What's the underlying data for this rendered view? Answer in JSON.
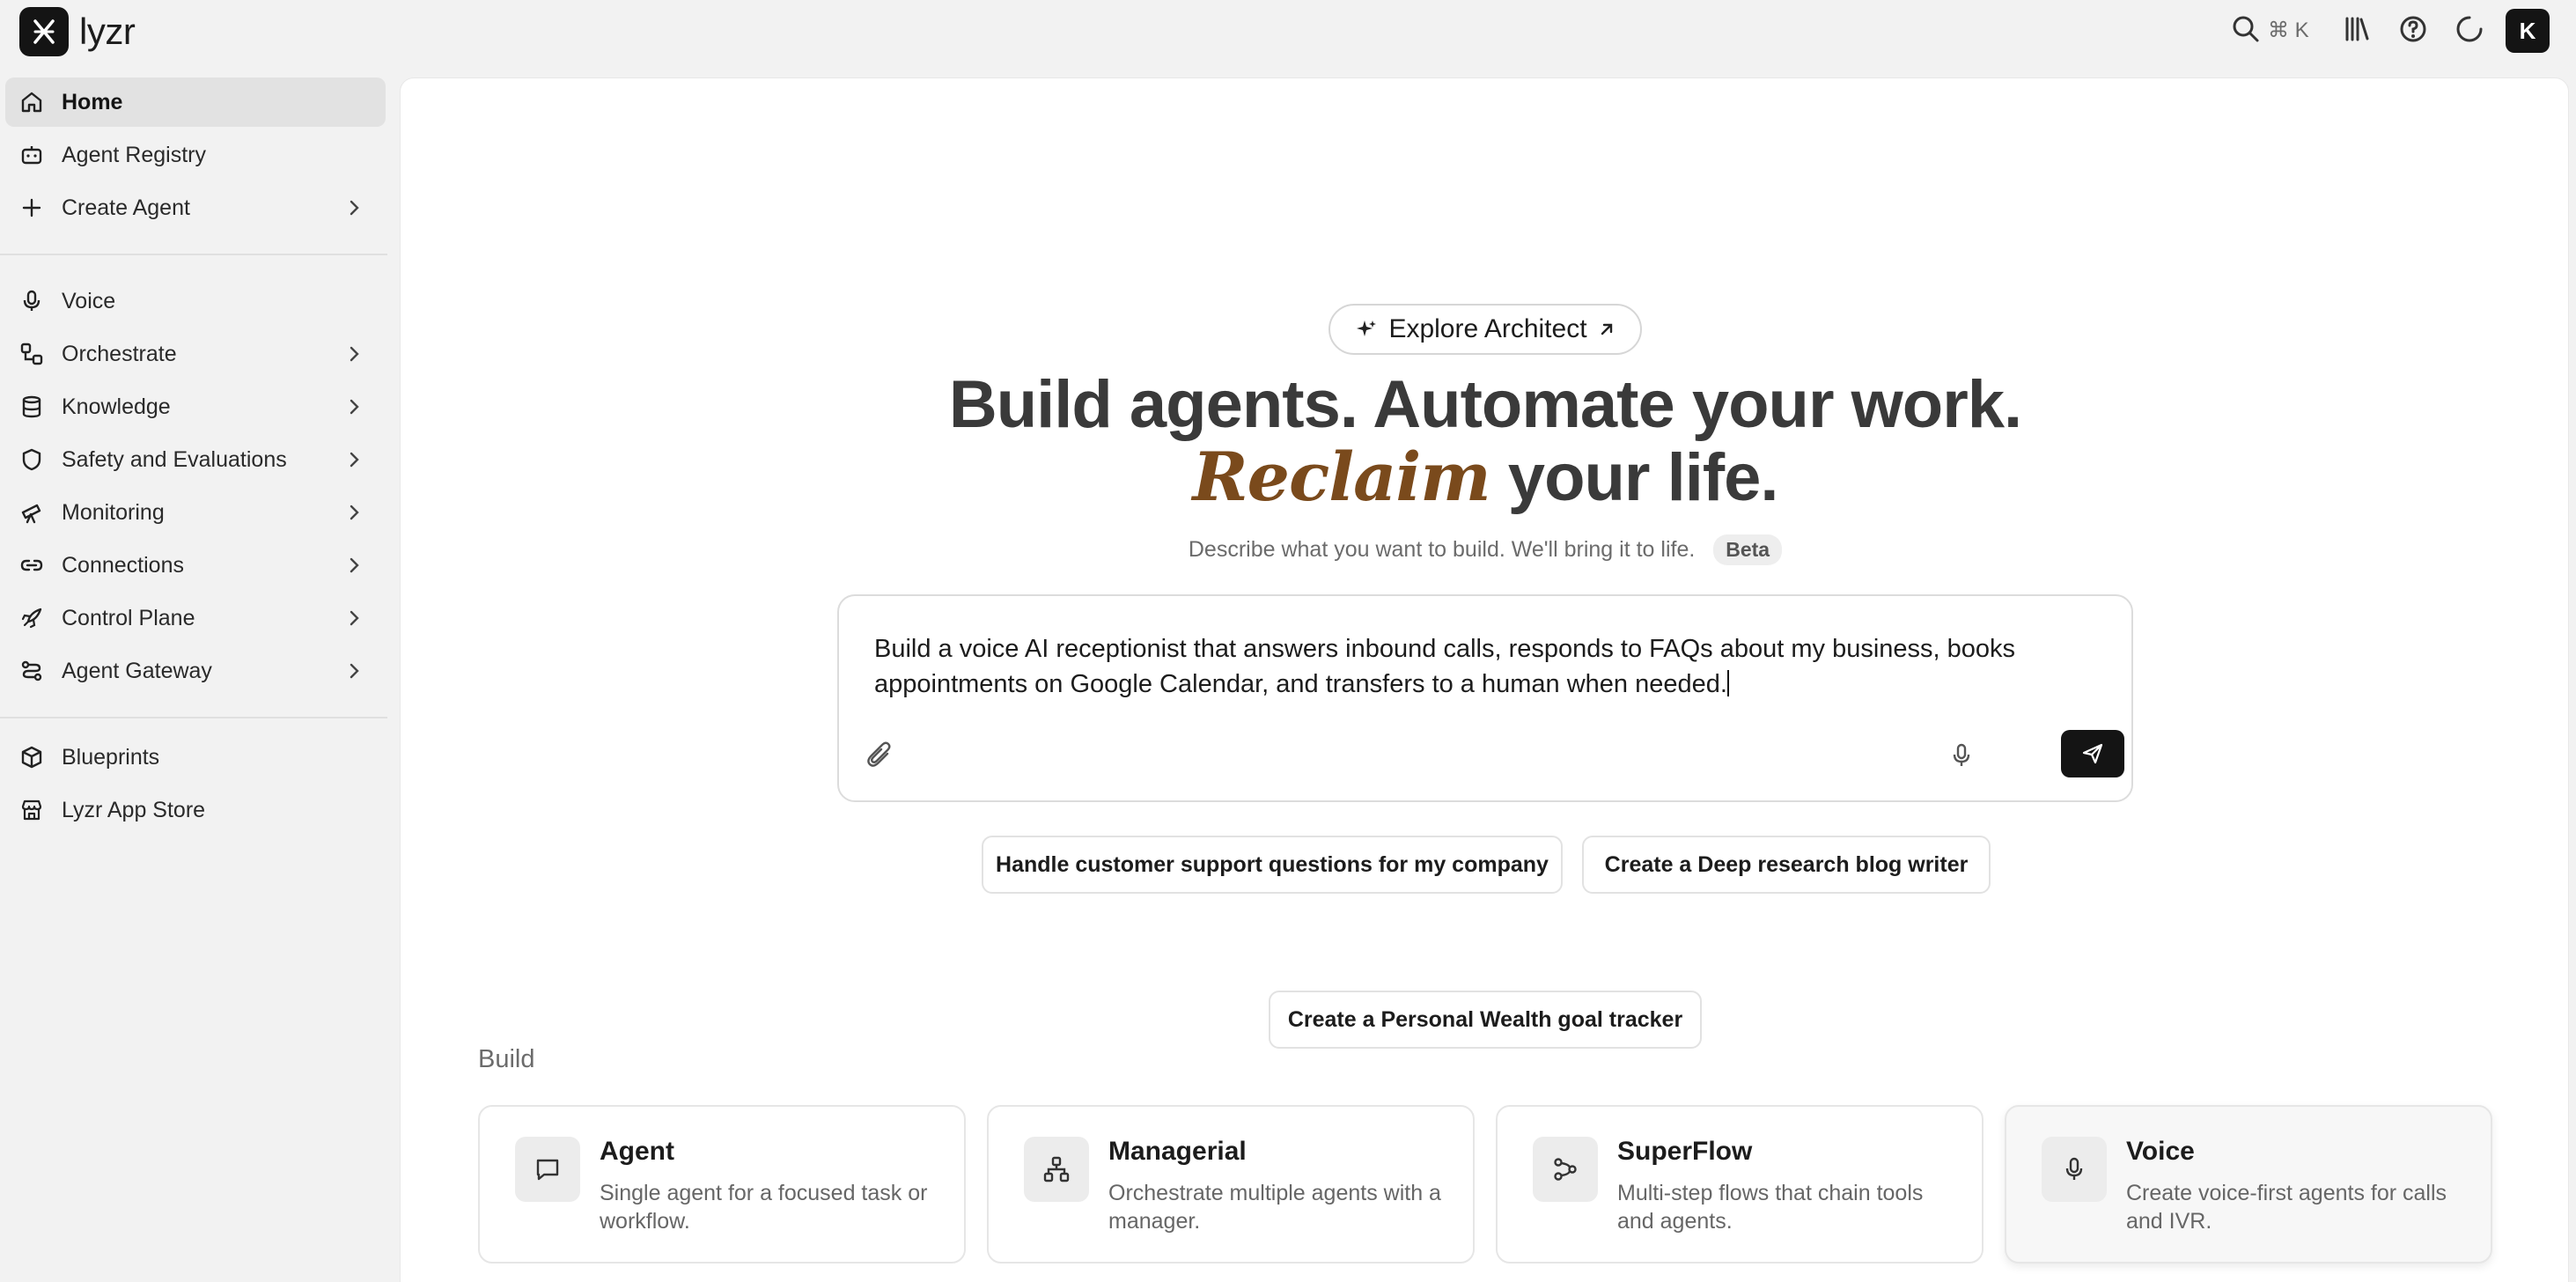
{
  "app": {
    "logo_text": "lyzr",
    "avatar_initial": "K",
    "search_shortcut": "⌘ K"
  },
  "sidebar": {
    "items": [
      {
        "label": "Home",
        "icon": "home-icon"
      },
      {
        "label": "Agent Registry",
        "icon": "bot-icon"
      },
      {
        "label": "Create Agent",
        "icon": "plus-icon"
      },
      {
        "label": "Voice",
        "icon": "mic-icon"
      },
      {
        "label": "Orchestrate",
        "icon": "workflow-icon"
      },
      {
        "label": "Knowledge",
        "icon": "database-icon"
      },
      {
        "label": "Safety and Evaluations",
        "icon": "shield-icon"
      },
      {
        "label": "Monitoring",
        "icon": "telescope-icon"
      },
      {
        "label": "Connections",
        "icon": "link-icon"
      },
      {
        "label": "Control Plane",
        "icon": "rocket-icon"
      },
      {
        "label": "Agent Gateway",
        "icon": "route-icon"
      },
      {
        "label": "Blueprints",
        "icon": "package-icon"
      },
      {
        "label": "Lyzr App Store",
        "icon": "store-icon"
      }
    ]
  },
  "hero": {
    "explore_label": "Explore Architect",
    "line1": "Build agents. Automate your work.",
    "line2_highlight": "Reclaim",
    "line2_rest": "your life.",
    "subtitle": "Describe what you want to build. We'll bring it to life.",
    "badge": "Beta"
  },
  "prompt": {
    "value": "Build a voice AI receptionist that answers inbound calls, responds to FAQs about my business, books appointments on Google Calendar, and transfers to a human when needed."
  },
  "suggestions": [
    "Handle customer support questions for my company",
    "Create a Deep research blog writer",
    "Create a Personal Wealth goal tracker"
  ],
  "build": {
    "title": "Build",
    "cards": [
      {
        "title": "Agent",
        "desc": "Single agent for a focused task or workflow.",
        "icon": "message-icon"
      },
      {
        "title": "Managerial",
        "desc": "Orchestrate multiple agents with a manager.",
        "icon": "hierarchy-icon"
      },
      {
        "title": "SuperFlow",
        "desc": "Multi-step flows that chain tools and agents.",
        "icon": "flow-icon"
      },
      {
        "title": "Voice",
        "desc": "Create voice-first agents for calls and IVR.",
        "icon": "mic-icon"
      }
    ]
  }
}
